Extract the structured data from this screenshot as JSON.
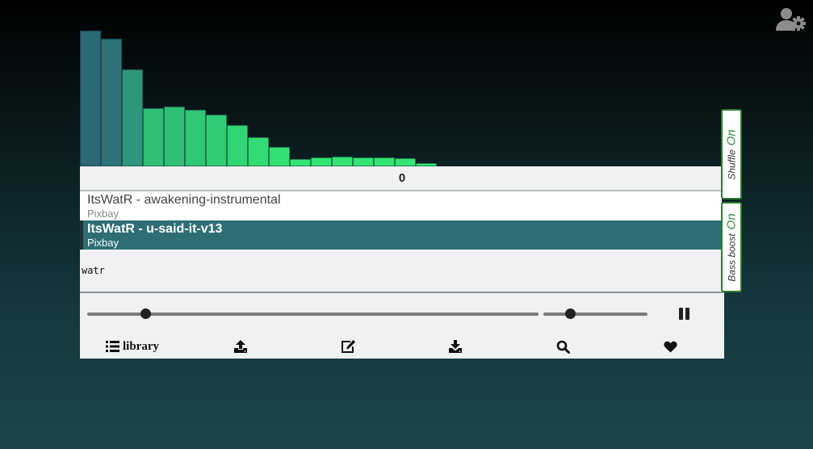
{
  "icons": {
    "account_settings": "user-gear-icon",
    "library": "list-icon",
    "upload": "upload-icon",
    "edit": "edit-icon",
    "download": "download-icon",
    "search": "search-icon",
    "favorites": "heart-icon",
    "play_state": "pause-icon"
  },
  "visualizer": {
    "levels": [
      168,
      158,
      120,
      72,
      74,
      70,
      64,
      51,
      36,
      24,
      9,
      11,
      12,
      11,
      11,
      10,
      4
    ],
    "level_max": 168,
    "colors": [
      "#2d6878",
      "#2d7279",
      "#2e967c",
      "#2fbf77",
      "#2fbf77",
      "#30c776",
      "#30cd75",
      "#30d574",
      "#31dc74",
      "#32e073",
      "#33e574",
      "#33e574",
      "#33e574",
      "#33e574",
      "#33e574",
      "#33e574",
      "#33e574"
    ]
  },
  "counter": "0",
  "playlist": [
    {
      "title": "ItsWatR - awakening-instrumental",
      "artist": "Pixbay",
      "active": false
    },
    {
      "title": "ItsWatR - u-said-it-v13",
      "artist": "Pixbay",
      "active": true
    }
  ],
  "search": {
    "value": "watr"
  },
  "toggles": {
    "shuffle": {
      "label": "Shuffle",
      "state": "On"
    },
    "bass_boost": {
      "label": "Bass boost",
      "state": "On"
    }
  },
  "controls": {
    "progress": 0.13,
    "volume": 0.26
  },
  "nav": {
    "library_label": "library"
  },
  "colors": {
    "accent_green": "#2e8b3a",
    "active_row": "#2e6e74",
    "panel": "#f0f1f2"
  }
}
